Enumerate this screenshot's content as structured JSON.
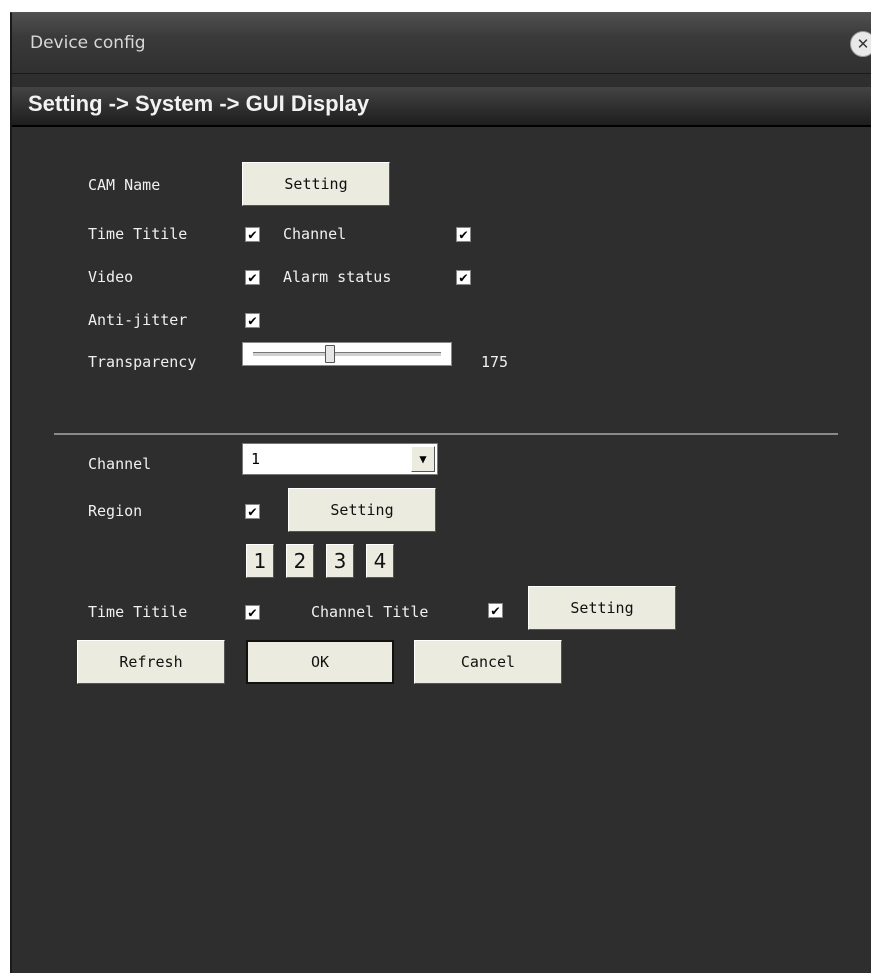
{
  "window": {
    "title": "Device config"
  },
  "breadcrumb": "Setting -> System -> GUI Display",
  "gui": {
    "cam_name": {
      "label": "CAM Name",
      "button": "Setting"
    },
    "time_title": {
      "label": "Time Titile",
      "checked": true
    },
    "channel": {
      "label": "Channel",
      "checked": true
    },
    "video": {
      "label": "Video",
      "checked": true
    },
    "alarm_status": {
      "label": "Alarm status",
      "checked": true
    },
    "anti_jitter": {
      "label": "Anti-jitter",
      "checked": true
    },
    "transparency": {
      "label": "Transparency",
      "value": "175",
      "fraction": 0.4
    }
  },
  "channel_section": {
    "channel_label": "Channel",
    "channel_value": "1",
    "region_label": "Region",
    "region_checked": true,
    "region_button": "Setting",
    "region_numbers": [
      "1",
      "2",
      "3",
      "4"
    ],
    "time_title_label": "Time Titile",
    "time_title_checked": true,
    "channel_title_label": "Channel Title",
    "channel_title_checked": true,
    "title_setting_button": "Setting"
  },
  "actions": {
    "refresh": "Refresh",
    "ok": "OK",
    "cancel": "Cancel"
  },
  "icons": {
    "check": "check-icon",
    "close": "close-icon",
    "dropdown": "chevron-down-icon"
  }
}
